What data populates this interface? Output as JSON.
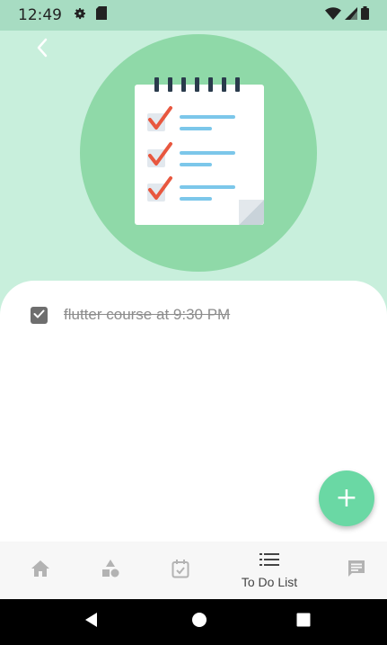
{
  "status_bar": {
    "time": "12:49",
    "left_icons": [
      "settings-icon",
      "sd-card-icon"
    ],
    "right_icons": [
      "wifi-icon",
      "signal-icon",
      "battery-icon"
    ]
  },
  "header": {
    "back_icon": "chevron-left-icon",
    "illustration": "checklist-notepad"
  },
  "todos": [
    {
      "text": "flutter course at 9:30 PM",
      "checked": true
    }
  ],
  "fab": {
    "label": "+"
  },
  "bottom_nav": {
    "items": [
      {
        "icon": "home-icon",
        "label": ""
      },
      {
        "icon": "shapes-icon",
        "label": ""
      },
      {
        "icon": "calendar-check-icon",
        "label": ""
      },
      {
        "icon": "list-icon",
        "label": "To Do List",
        "active": true
      },
      {
        "icon": "chat-icon",
        "label": ""
      }
    ]
  },
  "system_nav": [
    "back-icon",
    "home-icon",
    "recents-icon"
  ],
  "colors": {
    "background": "#c8efdc",
    "circle": "#8fd9a8",
    "fab": "#6ad8a4",
    "status_bar": "#a7dcc2"
  }
}
